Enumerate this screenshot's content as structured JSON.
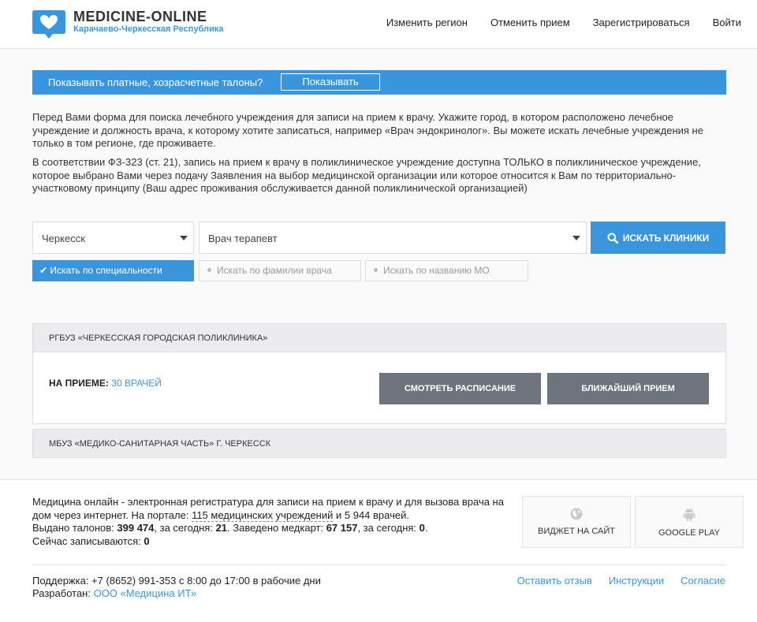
{
  "header": {
    "title": "MEDICINE-ONLINE",
    "region": "Карачаево-Черкесская Республика",
    "nav": [
      "Изменить регион",
      "Отменить прием",
      "Зарегистрироваться",
      "Войти"
    ]
  },
  "paid_bar": {
    "label": "Показывать платные, хозрасчетные талоны?",
    "button": "Показывать"
  },
  "info": {
    "p1": "Перед Вами форма для поиска лечебного учреждения для записи на прием к врачу. Укажите город, в котором расположено лечебное учреждение и должность врача, к которому хотите записаться, например «Врач эндокринолог». Вы можете искать лечебные учреждения не только в том регионе, где проживаете.",
    "p2": "В соответствии ФЗ-323 (ст. 21), запись на прием к врачу в поликлиническое учреждение доступна ТОЛЬКО в поликлиническое учреждение, которое выбрано Вами через подачу Заявления на выбор медицинской организации или которое относится к Вам по территориально-участковому принципу (Ваш адрес проживания обслуживается данной поликлинической организацией)"
  },
  "search": {
    "city": "Черкесск",
    "doctor": "Врач терапевт",
    "button": "ИСКАТЬ КЛИНИКИ",
    "modes": [
      "Искать по специальности",
      "Искать по фамилии врача",
      "Искать по названию МО"
    ]
  },
  "clinics": [
    {
      "name": "РГБУЗ «ЧЕРКЕССКАЯ ГОРОДСКАЯ ПОЛИКЛИНИКА»",
      "on_reception_label": "НА ПРИЕМЕ:",
      "doctors": "30 ВРАЧЕЙ",
      "schedule_button": "СМОТРЕТЬ РАСПИСАНИЕ",
      "nearest_button": "БЛИЖАЙШИЙ ПРИЕМ"
    },
    {
      "name": "МБУЗ «МЕДИКО-САНИТАРНАЯ ЧАСТЬ» Г. ЧЕРКЕССК"
    }
  ],
  "footer": {
    "desc_a": "Медицина онлайн - электронная регистратура для записи на прием к врачу и для вызова врача на дом через интернет. На портале: ",
    "institutions": "115 медицинских учреждений",
    "desc_b": " и 5 944 врачей.",
    "tickets_label": "Выдано талонов: ",
    "tickets": "399 474",
    "today_label": ", за сегодня: ",
    "tickets_today": "21",
    "cards_label": ". Заведено медкарт: ",
    "cards": "67 157",
    "cards_today_label": ", за сегодня: ",
    "cards_today": "0",
    "now_label": "Сейчас записываются: ",
    "now": "0",
    "widget_button": "ВИДЖЕТ НА САЙТ",
    "gplay_button": "GOOGLE PLAY",
    "support": "Поддержка: +7 (8652) 991-353 с 8:00 до 17:00 в рабочие дни",
    "developer_label": "Разработан: ",
    "developer": "ООО «Медицина ИТ»",
    "links": [
      "Оставить отзыв",
      "Инструкции",
      "Согласие"
    ]
  },
  "colors": {
    "accent": "#3a96dc",
    "button_gray": "#6c757d"
  }
}
